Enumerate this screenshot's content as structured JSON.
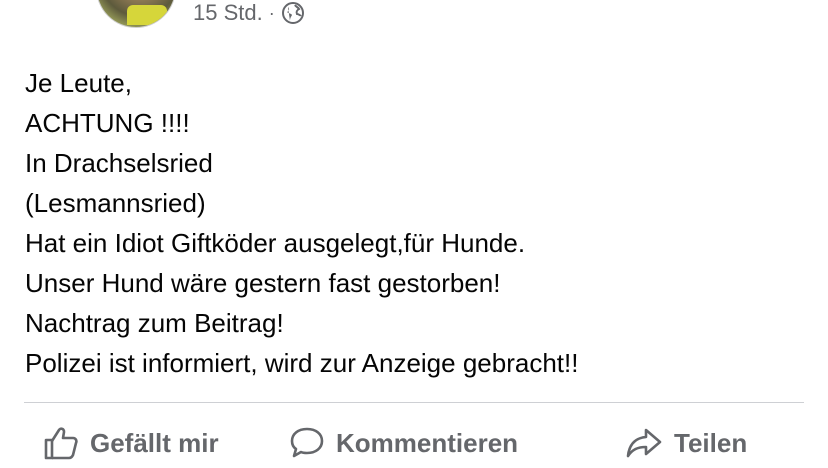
{
  "post": {
    "timestamp": "15 Std.",
    "separator": "·",
    "privacy_icon": "globe-icon",
    "lines": [
      "Je Leute,",
      "ACHTUNG !!!!",
      "In Drachselsried",
      "(Lesmannsried)",
      "Hat ein Idiot Giftköder ausgelegt,für Hunde.",
      "Unser Hund wäre gestern fast gestorben!",
      "Nachtrag zum Beitrag!",
      "Polizei ist informiert, wird zur Anzeige gebracht!!"
    ]
  },
  "actions": {
    "like": {
      "label": "Gefällt mir",
      "icon": "thumbs-up-icon"
    },
    "comment": {
      "label": "Kommentieren",
      "icon": "comment-icon"
    },
    "share": {
      "label": "Teilen",
      "icon": "share-icon"
    }
  },
  "colors": {
    "text": "#050505",
    "secondary": "#65676b",
    "divider": "#ced0d4"
  }
}
